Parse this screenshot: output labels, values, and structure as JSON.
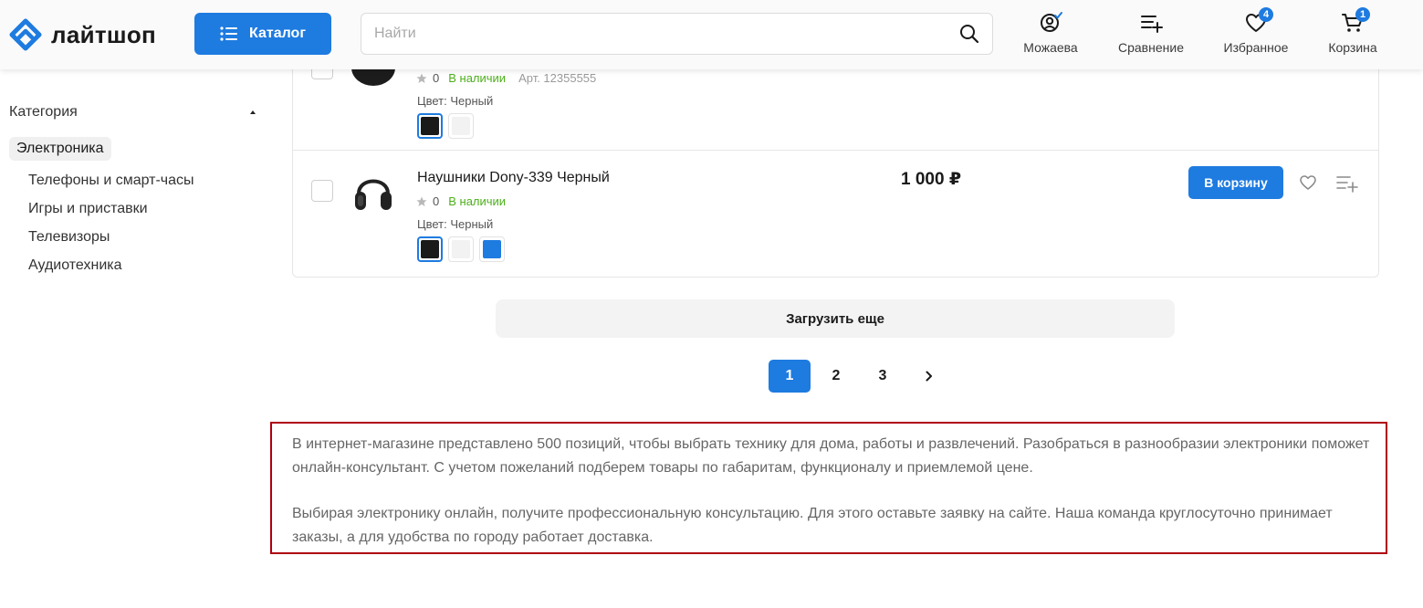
{
  "header": {
    "logo_text": "лайтшоп",
    "catalog_label": "Каталог",
    "search_placeholder": "Найти",
    "nav": [
      {
        "label": "Можаева",
        "icon": "user-icon"
      },
      {
        "label": "Сравнение",
        "icon": "compare-icon"
      },
      {
        "label": "Избранное",
        "icon": "heart-icon",
        "badge": "4"
      },
      {
        "label": "Корзина",
        "icon": "cart-icon",
        "badge": "1"
      }
    ],
    "accent_color": "#1e7be0"
  },
  "sidebar": {
    "heading": "Категория",
    "active": "Электроника",
    "items": [
      "Телефоны и смарт-часы",
      "Игры и приставки",
      "Телевизоры",
      "Аудиотехника"
    ]
  },
  "products": [
    {
      "rating": "0",
      "stock": "В наличии",
      "article": "Арт. 12355555",
      "color_label": "Цвет: Черный",
      "swatches": [
        "#1a1a1a",
        "#f2f2f2"
      ],
      "selected_swatch": 0
    },
    {
      "name": "Наушники Dony-339 Черный",
      "rating": "0",
      "stock": "В наличии",
      "color_label": "Цвет: Черный",
      "price": "1 000 ₽",
      "cart_label": "В корзину",
      "swatches": [
        "#1a1a1a",
        "#f2f2f2",
        "#1e7be0"
      ],
      "selected_swatch": 0
    }
  ],
  "load_more_label": "Загрузить еще",
  "pagination": {
    "pages": [
      "1",
      "2",
      "3"
    ],
    "current": "1"
  },
  "seo": {
    "p1": "В интернет-магазине представлено 500 позиций, чтобы выбрать технику для дома, работы и развлечений. Разобраться в разнообразии электроники поможет онлайн-консультант. С учетом пожеланий подберем товары по габаритам, функционалу и приемлемой цене.",
    "p2": "Выбирая электронику онлайн, получите профессиональную консультацию. Для этого оставьте заявку на сайте. Наша команда круглосуточно принимает заказы, а для удобства по городу работает доставка."
  }
}
